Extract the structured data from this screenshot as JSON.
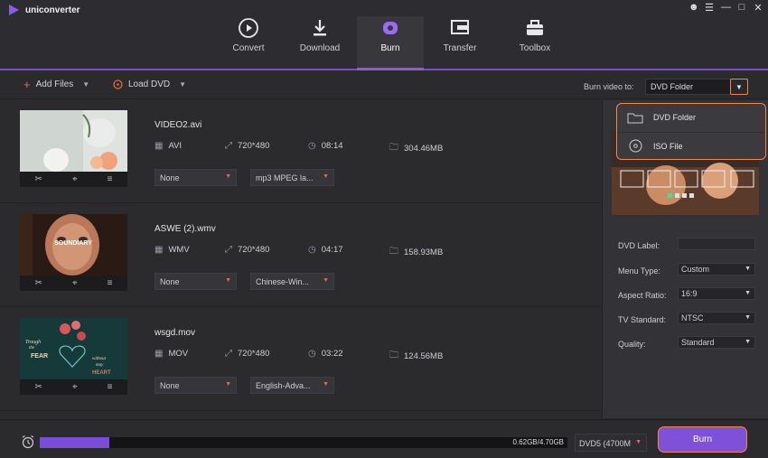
{
  "app": {
    "title": "uniconverter"
  },
  "nav": [
    {
      "label": "Convert",
      "icon": "convert-icon"
    },
    {
      "label": "Download",
      "icon": "download-icon"
    },
    {
      "label": "Burn",
      "icon": "burn-icon",
      "active": true
    },
    {
      "label": "Transfer",
      "icon": "transfer-icon"
    },
    {
      "label": "Toolbox",
      "icon": "toolbox-icon"
    }
  ],
  "toolbar": {
    "add_files": "Add Files",
    "load_dvd": "Load DVD",
    "burn_to_label": "Burn video to:",
    "burn_to_value": "DVD Folder"
  },
  "dropdown": {
    "items": [
      {
        "label": "DVD Folder",
        "icon": "folder-icon"
      },
      {
        "label": "ISO File",
        "icon": "disc-icon"
      }
    ]
  },
  "files": [
    {
      "name": "VIDEO2.avi",
      "format": "AVI",
      "resolution": "720*480",
      "duration": "08:14",
      "size": "304.46MB",
      "subtitle": "None",
      "audio": "mp3 MPEG la..."
    },
    {
      "name": "ASWE (2).wmv",
      "format": "WMV",
      "resolution": "720*480",
      "duration": "04:17",
      "size": "158.93MB",
      "subtitle": "None",
      "audio": "Chinese-Win..."
    },
    {
      "name": "wsgd.mov",
      "format": "MOV",
      "resolution": "720*480",
      "duration": "03:22",
      "size": "124.56MB",
      "subtitle": "None",
      "audio": "English-Adva..."
    }
  ],
  "thumb_text": {
    "second_overlay": "SOUNDIARY",
    "third_lines": [
      "Trough",
      "the",
      "FEAR",
      "without",
      "may",
      "HEART"
    ]
  },
  "settings": {
    "dvd_label": {
      "label": "DVD Label:",
      "value": ""
    },
    "menu_type": {
      "label": "Menu Type:",
      "value": "Custom"
    },
    "aspect_ratio": {
      "label": "Aspect Ratio:",
      "value": "16:9"
    },
    "tv_standard": {
      "label": "TV Standard:",
      "value": "NTSC"
    },
    "quality": {
      "label": "Quality:",
      "value": "Standard"
    }
  },
  "bottom": {
    "progress_text": "0.62GB/4.70GB",
    "progress_fraction": 0.132,
    "disc_type": "DVD5 (4700M",
    "burn_button": "Burn"
  },
  "colors": {
    "accent_purple": "#7b4bd6",
    "highlight_orange": "#f0884a"
  }
}
